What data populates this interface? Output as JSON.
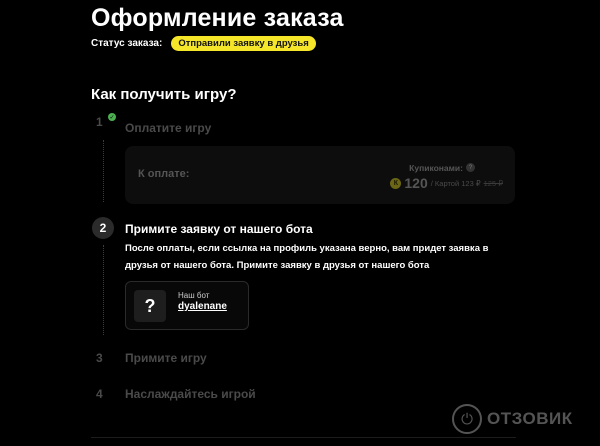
{
  "page": {
    "title": "Оформление заказа",
    "status_label": "Статус заказа:",
    "status_value": "Отправили заявку в друзья",
    "section_title": "Как получить игру?"
  },
  "steps": [
    {
      "number": "1",
      "label": "Оплатите игру",
      "completed": true
    },
    {
      "number": "2",
      "label": "Примите заявку от нашего бота",
      "active": true
    },
    {
      "number": "3",
      "label": "Примите игру"
    },
    {
      "number": "4",
      "label": "Наслаждайтесь игрой"
    }
  ],
  "payment": {
    "label": "К оплате:",
    "coupon_label": "Купиконами:",
    "coupon_help": "?",
    "coin_symbol": "К",
    "coupon_price": "120",
    "card_label": "/ Картой 123 ₽",
    "old_price": "125 ₽"
  },
  "step2": {
    "description": "После оплаты, если ссылка на профиль указана верно, вам придет заявка в друзья от нашего бота. Примите заявку в друзья от нашего бота"
  },
  "bot": {
    "avatar": "?",
    "label": "Наш бот",
    "name": "dyalenane"
  },
  "watermark": {
    "text": "ОТЗОВИК"
  },
  "colors": {
    "background": "#000000",
    "accent": "#f5e62a",
    "inactive": "#4a4a4a",
    "check": "#4caf50"
  }
}
